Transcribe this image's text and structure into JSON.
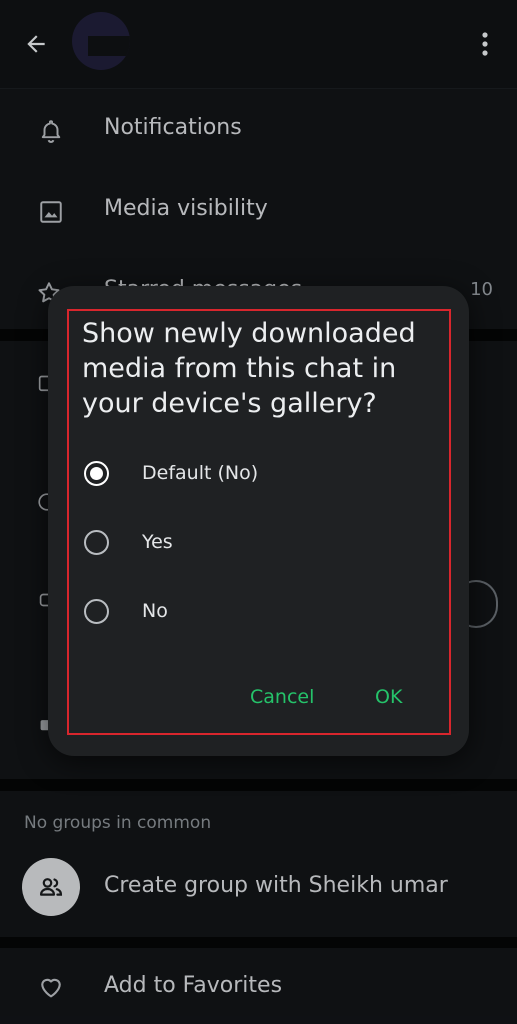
{
  "header": {
    "back_icon": "arrow-left-icon",
    "more_icon": "more-vertical-icon"
  },
  "settings": {
    "items": [
      {
        "label": "Notifications",
        "icon": "bell-icon"
      },
      {
        "label": "Media visibility",
        "icon": "image-icon"
      },
      {
        "label": "Starred messages",
        "icon": "star-icon",
        "count": "10"
      }
    ]
  },
  "groups": {
    "caption": "No groups in common",
    "create_label": "Create group with Sheikh umar",
    "create_icon": "group-icon"
  },
  "favorites": {
    "label": "Add to Favorites",
    "icon": "heart-icon"
  },
  "dialog": {
    "title": "Show newly downloaded media from this chat in your device's gallery?",
    "options": [
      {
        "label": "Default (No)",
        "selected": true
      },
      {
        "label": "Yes",
        "selected": false
      },
      {
        "label": "No",
        "selected": false
      }
    ],
    "cancel_label": "Cancel",
    "ok_label": "OK"
  },
  "colors": {
    "accent": "#25c36a",
    "highlight": "#d8262d",
    "dialog_bg": "#1f2123",
    "page_bg": "#0b0c0e"
  }
}
